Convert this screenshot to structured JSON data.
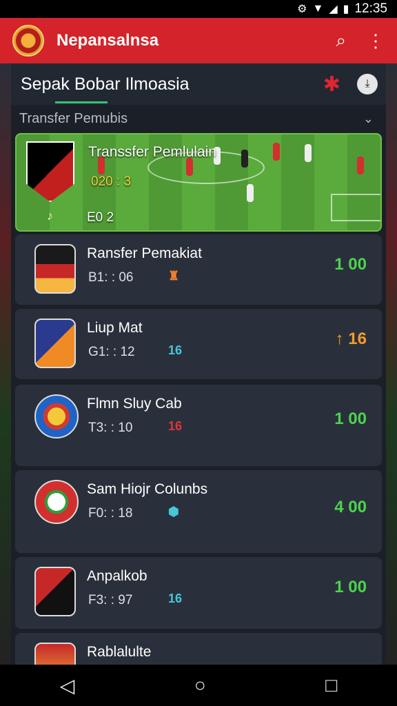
{
  "status": {
    "time": "12:35"
  },
  "appbar": {
    "title": "Nepansalnsa"
  },
  "tabbar": {
    "title": "Sepak Bobar Ilmoasia"
  },
  "filter": {
    "label": "Transfer Pemubis"
  },
  "hero": {
    "title": "Transsfer Pemlulain",
    "score": "020 : 3",
    "foot": "E0 2"
  },
  "cards": [
    {
      "name": "Ransfer Pemakiat",
      "meta": "B1: : 06",
      "result": "1 00",
      "result_color": "#4cd44c"
    },
    {
      "name": "Liup Mat",
      "meta": "G1: : 12",
      "badge": "16",
      "badge_color": "#47c6d8",
      "result": "16",
      "result_color": "#f39c2a"
    },
    {
      "name": "Flmn Sluy Cab",
      "meta": "T3: : 10",
      "badge": "16",
      "badge_color": "#e0353a",
      "result": "1 00",
      "result_color": "#4cd44c"
    },
    {
      "name": "Sam Hiojr Colunbs",
      "meta": "F0: : 18",
      "result": "4 00",
      "result_color": "#4cd44c"
    },
    {
      "name": "Anpalkob",
      "meta": "F3: : 97",
      "badge": "16",
      "badge_color": "#47c6d8",
      "result": "1 00",
      "result_color": "#4cd44c"
    },
    {
      "name": "Rablalulte"
    }
  ]
}
